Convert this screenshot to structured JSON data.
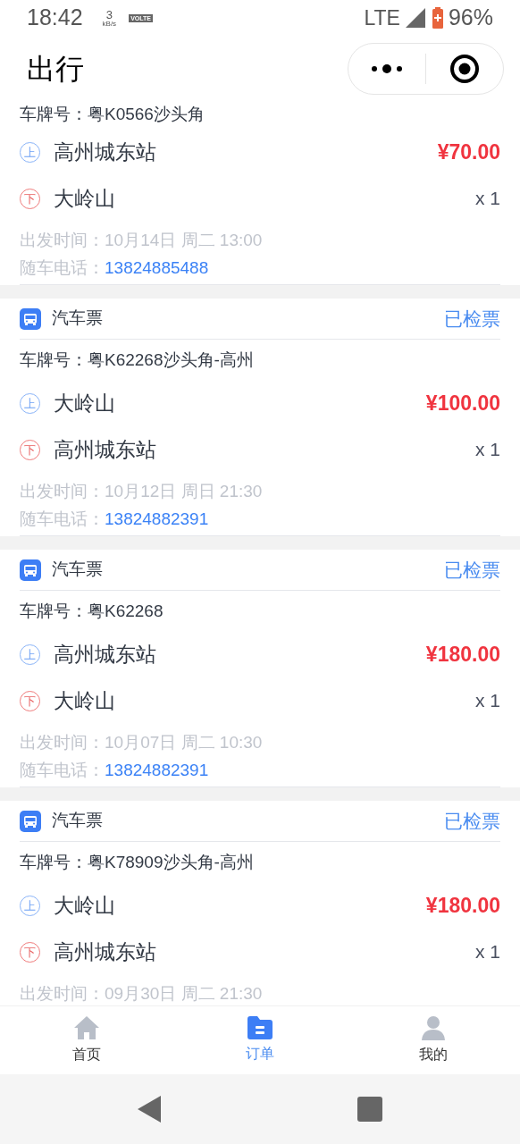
{
  "status_bar": {
    "time": "18:42",
    "speed_value": "3",
    "speed_unit": "kB/s",
    "volte": "VOLTE",
    "network": "LTE",
    "battery": "96%"
  },
  "header": {
    "title": "出行"
  },
  "orders": [
    {
      "plate": "车牌号：粤K0566沙头角",
      "stops": [
        {
          "kind": "board",
          "mark": "上",
          "name": "高州城东站",
          "info": "¥70.00"
        },
        {
          "kind": "alight",
          "mark": "下",
          "name": "大岭山",
          "info": "x 1"
        }
      ],
      "departure_label": "出发时间：",
      "departure": "10月14日 周二 13:00",
      "phone_label": "随车电话：",
      "phone": "13824885488"
    },
    {
      "ticket_type": "汽车票",
      "status": "已检票",
      "plate": "车牌号：粤K62268沙头角-高州",
      "stops": [
        {
          "kind": "board",
          "mark": "上",
          "name": "大岭山",
          "info": "¥100.00"
        },
        {
          "kind": "alight",
          "mark": "下",
          "name": "高州城东站",
          "info": "x 1"
        }
      ],
      "departure_label": "出发时间：",
      "departure": "10月12日 周日 21:30",
      "phone_label": "随车电话：",
      "phone": "13824882391"
    },
    {
      "ticket_type": "汽车票",
      "status": "已检票",
      "plate": "车牌号：粤K62268",
      "stops": [
        {
          "kind": "board",
          "mark": "上",
          "name": "高州城东站",
          "info": "¥180.00"
        },
        {
          "kind": "alight",
          "mark": "下",
          "name": "大岭山",
          "info": "x 1"
        }
      ],
      "departure_label": "出发时间：",
      "departure": "10月07日 周二 10:30",
      "phone_label": "随车电话：",
      "phone": "13824882391"
    },
    {
      "ticket_type": "汽车票",
      "status": "已检票",
      "plate": "车牌号：粤K78909沙头角-高州",
      "stops": [
        {
          "kind": "board",
          "mark": "上",
          "name": "大岭山",
          "info": "¥180.00"
        },
        {
          "kind": "alight",
          "mark": "下",
          "name": "高州城东站",
          "info": "x 1"
        }
      ],
      "departure_label": "出发时间：",
      "departure": "09月30日 周二 21:30"
    }
  ],
  "tab_bar": [
    {
      "kind": "home",
      "label": "首页",
      "selected": false
    },
    {
      "kind": "orders",
      "label": "订单",
      "selected": true
    },
    {
      "kind": "profile",
      "label": "我的",
      "selected": false
    }
  ]
}
